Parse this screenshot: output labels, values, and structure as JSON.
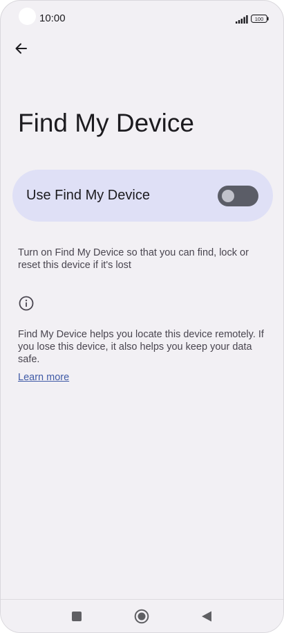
{
  "status_bar": {
    "time": "10:00",
    "battery": "100"
  },
  "page": {
    "title": "Find My Device"
  },
  "setting": {
    "label": "Use Find My Device",
    "enabled": false
  },
  "description": "Turn on Find My Device so that you can find, lock or reset this device if it's lost",
  "info": {
    "text": "Find My Device helps you locate this device remotely. If you lose this device, it also helps you keep your data safe.",
    "link_label": "Learn more"
  },
  "icons": {
    "back": "arrow-left-icon",
    "info": "info-circle-icon",
    "recents": "square-icon",
    "home": "circle-icon",
    "nav_back": "triangle-left-icon"
  },
  "colors": {
    "background": "#f2f0f4",
    "card": "#dfe0f6",
    "switch_track": "#5b5d67",
    "link": "#3f5aa6"
  }
}
